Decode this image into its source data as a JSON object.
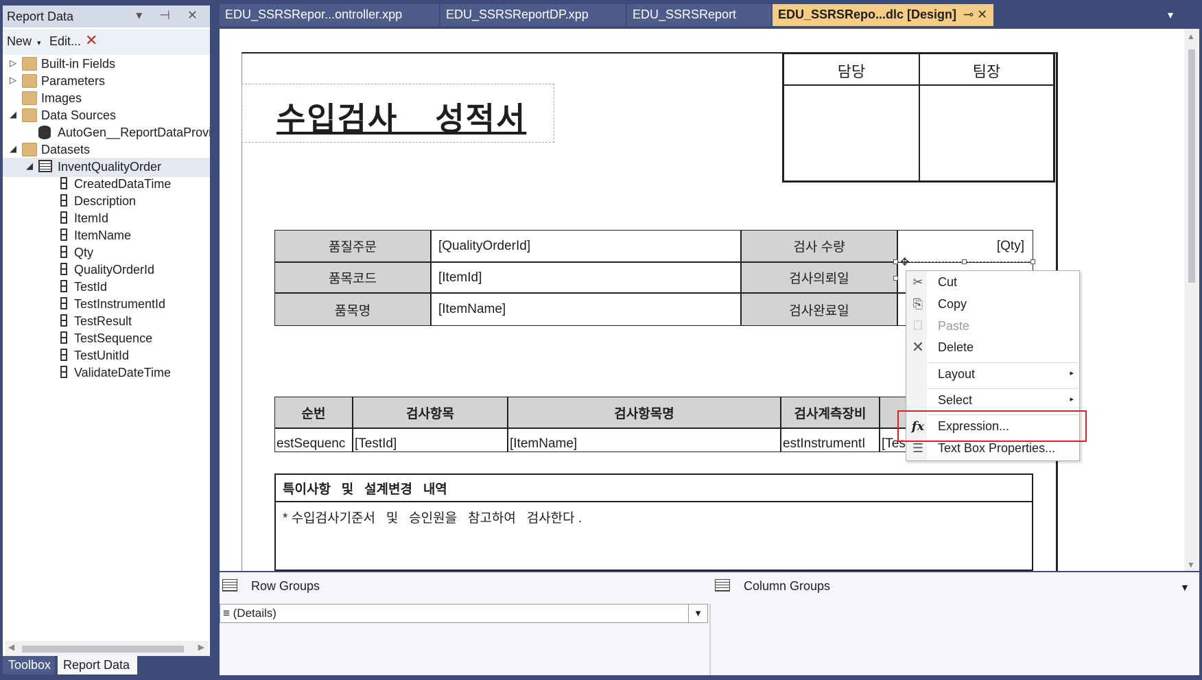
{
  "left_panel": {
    "title": "Report Data",
    "header_icons": "▾ ⊣ ✕",
    "toolbar": {
      "new_label": "New",
      "new_arrow": "▾",
      "edit_label": "Edit...",
      "delete_glyph": "✕"
    },
    "tree": [
      {
        "label": "Built-in Fields",
        "arrow": "▷",
        "icon": "folder"
      },
      {
        "label": "Parameters",
        "arrow": "▷",
        "icon": "folder"
      },
      {
        "label": "Images",
        "arrow": "",
        "icon": "folder"
      },
      {
        "label": "Data Sources",
        "arrow": "◢",
        "icon": "folder-open"
      },
      {
        "label": "AutoGen__ReportDataProvider",
        "arrow": "",
        "icon": "database"
      },
      {
        "label": "Datasets",
        "arrow": "◢",
        "icon": "folder-open"
      },
      {
        "label": "InventQualityOrder",
        "arrow": "◢",
        "icon": "table"
      },
      {
        "label": "CreatedDataTime",
        "arrow": "",
        "icon": "field"
      },
      {
        "label": "Description",
        "arrow": "",
        "icon": "field"
      },
      {
        "label": "ItemId",
        "arrow": "",
        "icon": "field"
      },
      {
        "label": "ItemName",
        "arrow": "",
        "icon": "field"
      },
      {
        "label": "Qty",
        "arrow": "",
        "icon": "field"
      },
      {
        "label": "QualityOrderId",
        "arrow": "",
        "icon": "field"
      },
      {
        "label": "TestId",
        "arrow": "",
        "icon": "field"
      },
      {
        "label": "TestInstrumentId",
        "arrow": "",
        "icon": "field"
      },
      {
        "label": "TestResult",
        "arrow": "",
        "icon": "field"
      },
      {
        "label": "TestSequence",
        "arrow": "",
        "icon": "field"
      },
      {
        "label": "TestUnitId",
        "arrow": "",
        "icon": "field"
      },
      {
        "label": "ValidateDateTime",
        "arrow": "",
        "icon": "field"
      }
    ],
    "bottom_tabs": {
      "toolbox": "Toolbox",
      "report_data": "Report Data"
    }
  },
  "doc_tabs": [
    {
      "label": "EDU_SSRSRepor...ontroller.xpp",
      "active": false
    },
    {
      "label": "EDU_SSRSReportDP.xpp",
      "active": false
    },
    {
      "label": "EDU_SSRSReport",
      "active": false
    },
    {
      "label": "EDU_SSRSRepo...dlc [Design]",
      "active": true,
      "icons": "⊸ ✕"
    }
  ],
  "tab_menu_icon": "▾",
  "report": {
    "title": "수입검사   성적서",
    "approval": {
      "col1": "담당",
      "col2": "팀장"
    },
    "info_rows": [
      {
        "label1": "품질주문",
        "value1": "[QualityOrderId]",
        "label2": "검사   수량",
        "value2": "[Qty]"
      },
      {
        "label1": "품목코드",
        "value1": "[ItemId]",
        "label2": "검사의뢰일",
        "value2": ""
      },
      {
        "label1": "품목명",
        "value1": "[ItemName]",
        "label2": "검사완료일",
        "value2": ""
      }
    ],
    "detail_headers": [
      "순번",
      "검사항목",
      "검사항목명",
      "검사계측장비",
      ""
    ],
    "detail_values": [
      "estSequenc",
      "[TestId]",
      "[ItemName]",
      "estInstrumentI",
      "[Tes"
    ],
    "notes": {
      "header": "특이사항   및   설계변경   내역",
      "body": "* 수입검사기준서   및   승인원을   참고하여   검사한다 ."
    }
  },
  "context_menu": {
    "items": [
      {
        "label": "Cut",
        "icon": "scissors",
        "glyph": "✂",
        "disabled": false
      },
      {
        "label": "Copy",
        "icon": "copy",
        "glyph": "⎘",
        "disabled": false
      },
      {
        "label": "Paste",
        "icon": "paste",
        "glyph": "📋",
        "disabled": true
      },
      {
        "label": "Delete",
        "icon": "delete",
        "glyph": "✕",
        "disabled": false
      },
      {
        "label": "Layout",
        "icon": "",
        "glyph": "",
        "submenu": true
      },
      {
        "label": "Select",
        "icon": "",
        "glyph": "",
        "submenu": true
      },
      {
        "label": "Expression...",
        "icon": "function",
        "glyph": "fx",
        "disabled": false
      },
      {
        "label": "Text Box Properties...",
        "icon": "properties",
        "glyph": "☰",
        "disabled": false
      }
    ],
    "submenu_arrow": "▸",
    "highlight_color": "#e02020"
  },
  "groups": {
    "row_groups_label": "Row Groups",
    "column_groups_label": "Column Groups",
    "details_label": "≡ (Details)",
    "dropdown_arrow": "▼",
    "collapse_arrow": "▼"
  },
  "colors": {
    "chrome": "#3c4b7a",
    "active_tab": "#f5cc84",
    "header_gray": "#d3d3d3"
  }
}
